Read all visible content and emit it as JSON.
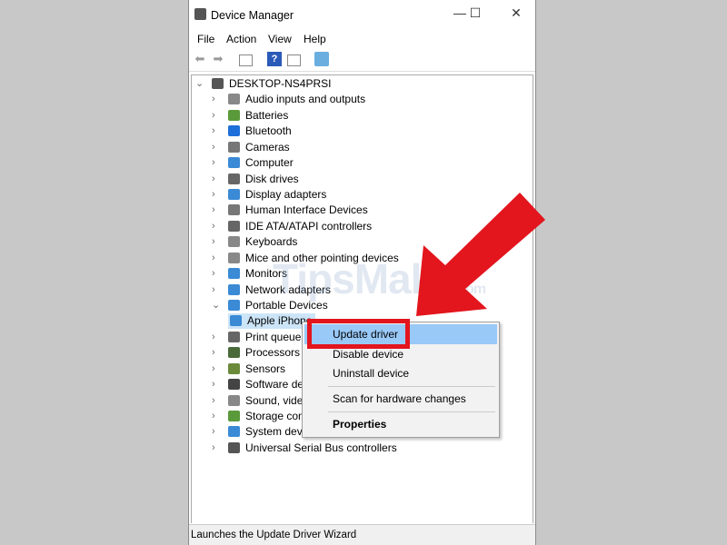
{
  "window": {
    "title": "Device Manager",
    "minimize": "—",
    "maximize": "☐",
    "close": "✕"
  },
  "menu": [
    "File",
    "Action",
    "View",
    "Help"
  ],
  "toolbar": [
    "back-icon",
    "forward-icon",
    "show-hide-console-tree-icon",
    "help-icon",
    "action-pane-icon",
    "scan-hardware-icon"
  ],
  "tree": {
    "root": "DESKTOP-NS4PRSI",
    "items": [
      {
        "label": "Audio inputs and outputs",
        "color": "#888"
      },
      {
        "label": "Batteries",
        "color": "#5a9a3a"
      },
      {
        "label": "Bluetooth",
        "color": "#1e6fd9"
      },
      {
        "label": "Cameras",
        "color": "#777"
      },
      {
        "label": "Computer",
        "color": "#3a8ad6"
      },
      {
        "label": "Disk drives",
        "color": "#666"
      },
      {
        "label": "Display adapters",
        "color": "#3a8ad6"
      },
      {
        "label": "Human Interface Devices",
        "color": "#777"
      },
      {
        "label": "IDE ATA/ATAPI controllers",
        "color": "#666"
      },
      {
        "label": "Keyboards",
        "color": "#888"
      },
      {
        "label": "Mice and other pointing devices",
        "color": "#888"
      },
      {
        "label": "Monitors",
        "color": "#3a8ad6"
      },
      {
        "label": "Network adapters",
        "color": "#3a8ad6"
      },
      {
        "label": "Portable Devices",
        "color": "#3a8ad6",
        "expanded": true
      },
      {
        "label": "Apple iPhone",
        "color": "#3a8ad6",
        "child": true
      },
      {
        "label": "Print queues",
        "color": "#666"
      },
      {
        "label": "Processors",
        "color": "#4a6a3a"
      },
      {
        "label": "Sensors",
        "color": "#6a8a3a"
      },
      {
        "label": "Software devices",
        "color": "#444"
      },
      {
        "label": "Sound, video and game controllers",
        "color": "#888"
      },
      {
        "label": "Storage controllers",
        "color": "#5a9a3a"
      },
      {
        "label": "System devices",
        "color": "#3a8ad6"
      },
      {
        "label": "Universal Serial Bus controllers",
        "color": "#555"
      }
    ]
  },
  "context_menu": {
    "items": [
      "Update driver",
      "Disable device",
      "Uninstall device",
      "Scan for hardware changes",
      "Properties"
    ]
  },
  "status": "Launches the Update Driver Wizard",
  "watermark": "TipsMake.com",
  "accent": {
    "highlight": "#e3151d",
    "selection": "#99c9f7"
  }
}
